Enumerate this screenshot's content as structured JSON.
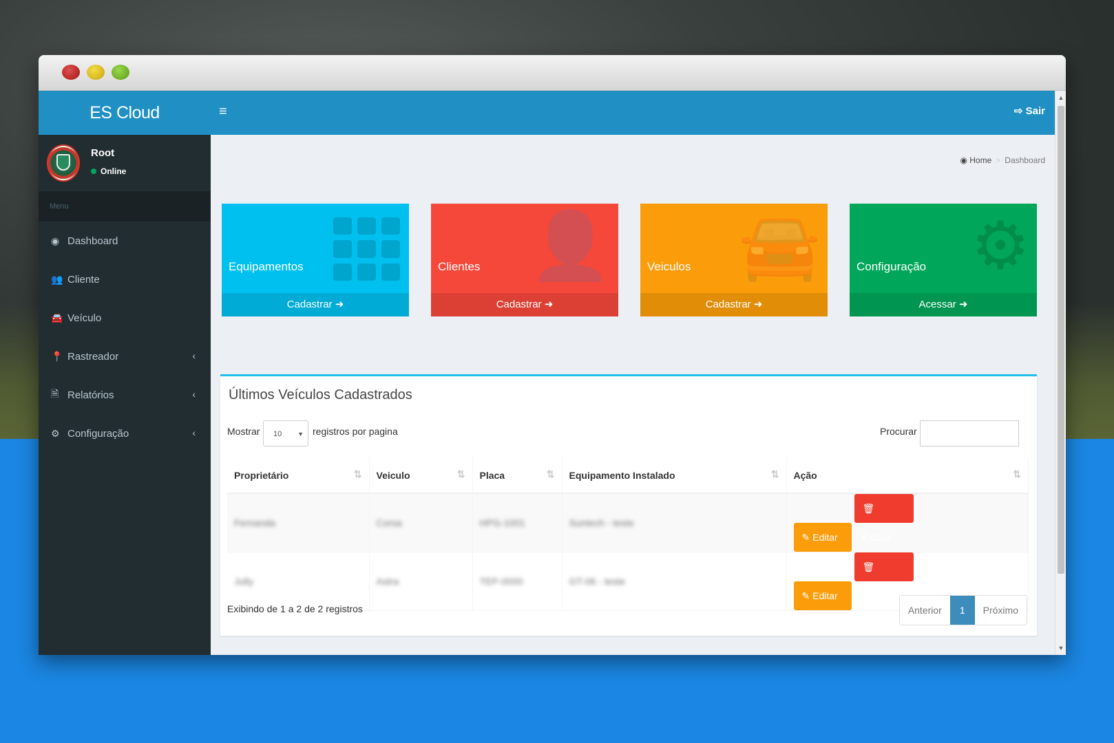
{
  "app": {
    "brand": "ES Cloud",
    "logout_label": "Sair"
  },
  "user": {
    "name": "Root",
    "status": "Online"
  },
  "sidebar": {
    "menu_header": "Menu",
    "items": [
      {
        "label": "Dashboard",
        "icon": "dashboard-icon",
        "glyph": "◉",
        "has_chevron": false
      },
      {
        "label": "Cliente",
        "icon": "users-icon",
        "glyph": "👥",
        "has_chevron": false
      },
      {
        "label": "Veículo",
        "icon": "car-icon",
        "glyph": "🚘",
        "has_chevron": false
      },
      {
        "label": "Rastreador",
        "icon": "map-marker-icon",
        "glyph": "📍",
        "has_chevron": true
      },
      {
        "label": "Relatórios",
        "icon": "file-icon",
        "glyph": "🗎",
        "has_chevron": true
      },
      {
        "label": "Configuração",
        "icon": "gears-icon",
        "glyph": "⚙",
        "has_chevron": true
      }
    ],
    "chevron": "‹"
  },
  "breadcrumb": {
    "home": "Home",
    "current": "Dashboard",
    "separator": ">"
  },
  "tiles": [
    {
      "title": "Equipamentos",
      "footer": "Cadastrar",
      "color": "#00c0ef",
      "icon": "grid-icon"
    },
    {
      "title": "Clientes",
      "footer": "Cadastrar",
      "color": "#f5483a",
      "icon": "user-plus-icon"
    },
    {
      "title": "Veiculos",
      "footer": "Cadastrar",
      "color": "#fb9d0a",
      "icon": "car-icon"
    },
    {
      "title": "Configuração",
      "footer": "Acessar",
      "color": "#00a65a",
      "icon": "gear-icon"
    }
  ],
  "table_box": {
    "title": "Últimos Veículos Cadastrados",
    "show_label": "Mostrar",
    "length_value": "10",
    "per_page_label": "registros por pagina",
    "search_label": "Procurar",
    "columns": [
      "Proprietário",
      "Veiculo",
      "Placa",
      "Equipamento Instalado",
      "Ação"
    ],
    "rows": [
      {
        "owner": "Fernanda",
        "vehicle": "Corsa",
        "plate": "HPG-1001",
        "equipment": "Suntech - teste"
      },
      {
        "owner": "Jully",
        "vehicle": "Astra",
        "plate": "TEP-0000",
        "equipment": "GT-06 - teste"
      }
    ],
    "edit_label": "Editar",
    "delete_label": "Excluir",
    "info": "Exibindo de 1 a 2 de 2 registros",
    "pager": {
      "prev": "Anterior",
      "current": "1",
      "next": "Próximo"
    }
  }
}
